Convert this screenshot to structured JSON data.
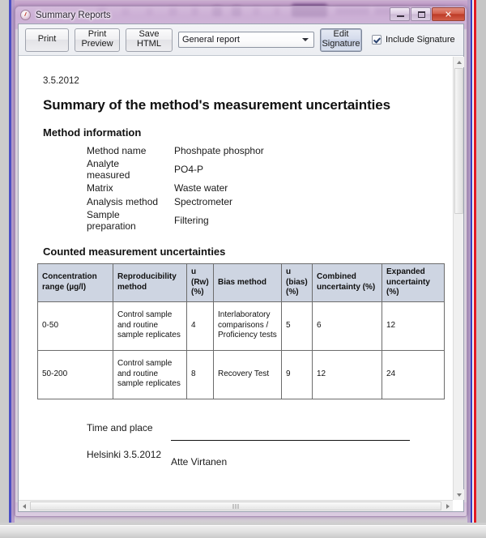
{
  "window": {
    "title": "Summary Reports",
    "icon": "app-gauge-icon",
    "buttons": {
      "minimize": "–",
      "maximize": "□",
      "close": "✕"
    }
  },
  "toolbar": {
    "print_label": "Print",
    "print_preview_label": "Print\nPreview",
    "save_html_label": "Save HTML",
    "report_type_value": "General report",
    "report_type_options": [
      "General report"
    ],
    "edit_signature_label": "Edit\nSignature",
    "include_signature_label": "Include Signature",
    "include_signature_checked": true
  },
  "document": {
    "date": "3.5.2012",
    "title": "Summary of the method's measurement uncertainties",
    "method_info_heading": "Method information",
    "method_info": [
      {
        "key": "Method name",
        "value": "Phoshpate phosphor"
      },
      {
        "key": "Analyte measured",
        "value": "PO4-P"
      },
      {
        "key": "Matrix",
        "value": "Waste water"
      },
      {
        "key": "Analysis method",
        "value": "Spectrometer"
      },
      {
        "key": "Sample preparation",
        "value": "Filtering"
      }
    ],
    "table_heading": "Counted measurement uncertainties",
    "signature": {
      "time_and_place_label": "Time and place",
      "place_and_date": "Helsinki 3.5.2012",
      "signer_name": "Atte Virtanen"
    }
  },
  "chart_data": {
    "type": "table",
    "title": "Counted measurement uncertainties",
    "columns": [
      "Concentration range (µg/l)",
      "Reproducibility method",
      "u (Rw) (%)",
      "Bias method",
      "u (bias) (%)",
      "Combined uncertainty (%)",
      "Expanded uncertainty (%)"
    ],
    "rows": [
      [
        "0-50",
        "Control sample and routine sample replicates",
        "4",
        "Interlaboratory comparisons / Proficiency tests",
        "5",
        "6",
        "12"
      ],
      [
        "50-200",
        "Control sample and routine sample replicates",
        "8",
        "Recovery Test",
        "9",
        "12",
        "24"
      ]
    ]
  },
  "scrollbars": {
    "vertical_position_percent": 3,
    "horizontal_position_percent": 50
  },
  "colors": {
    "table_header_bg": "#ced5e2",
    "close_button": "#bd3b27",
    "window_glass": "#ddcde4"
  }
}
